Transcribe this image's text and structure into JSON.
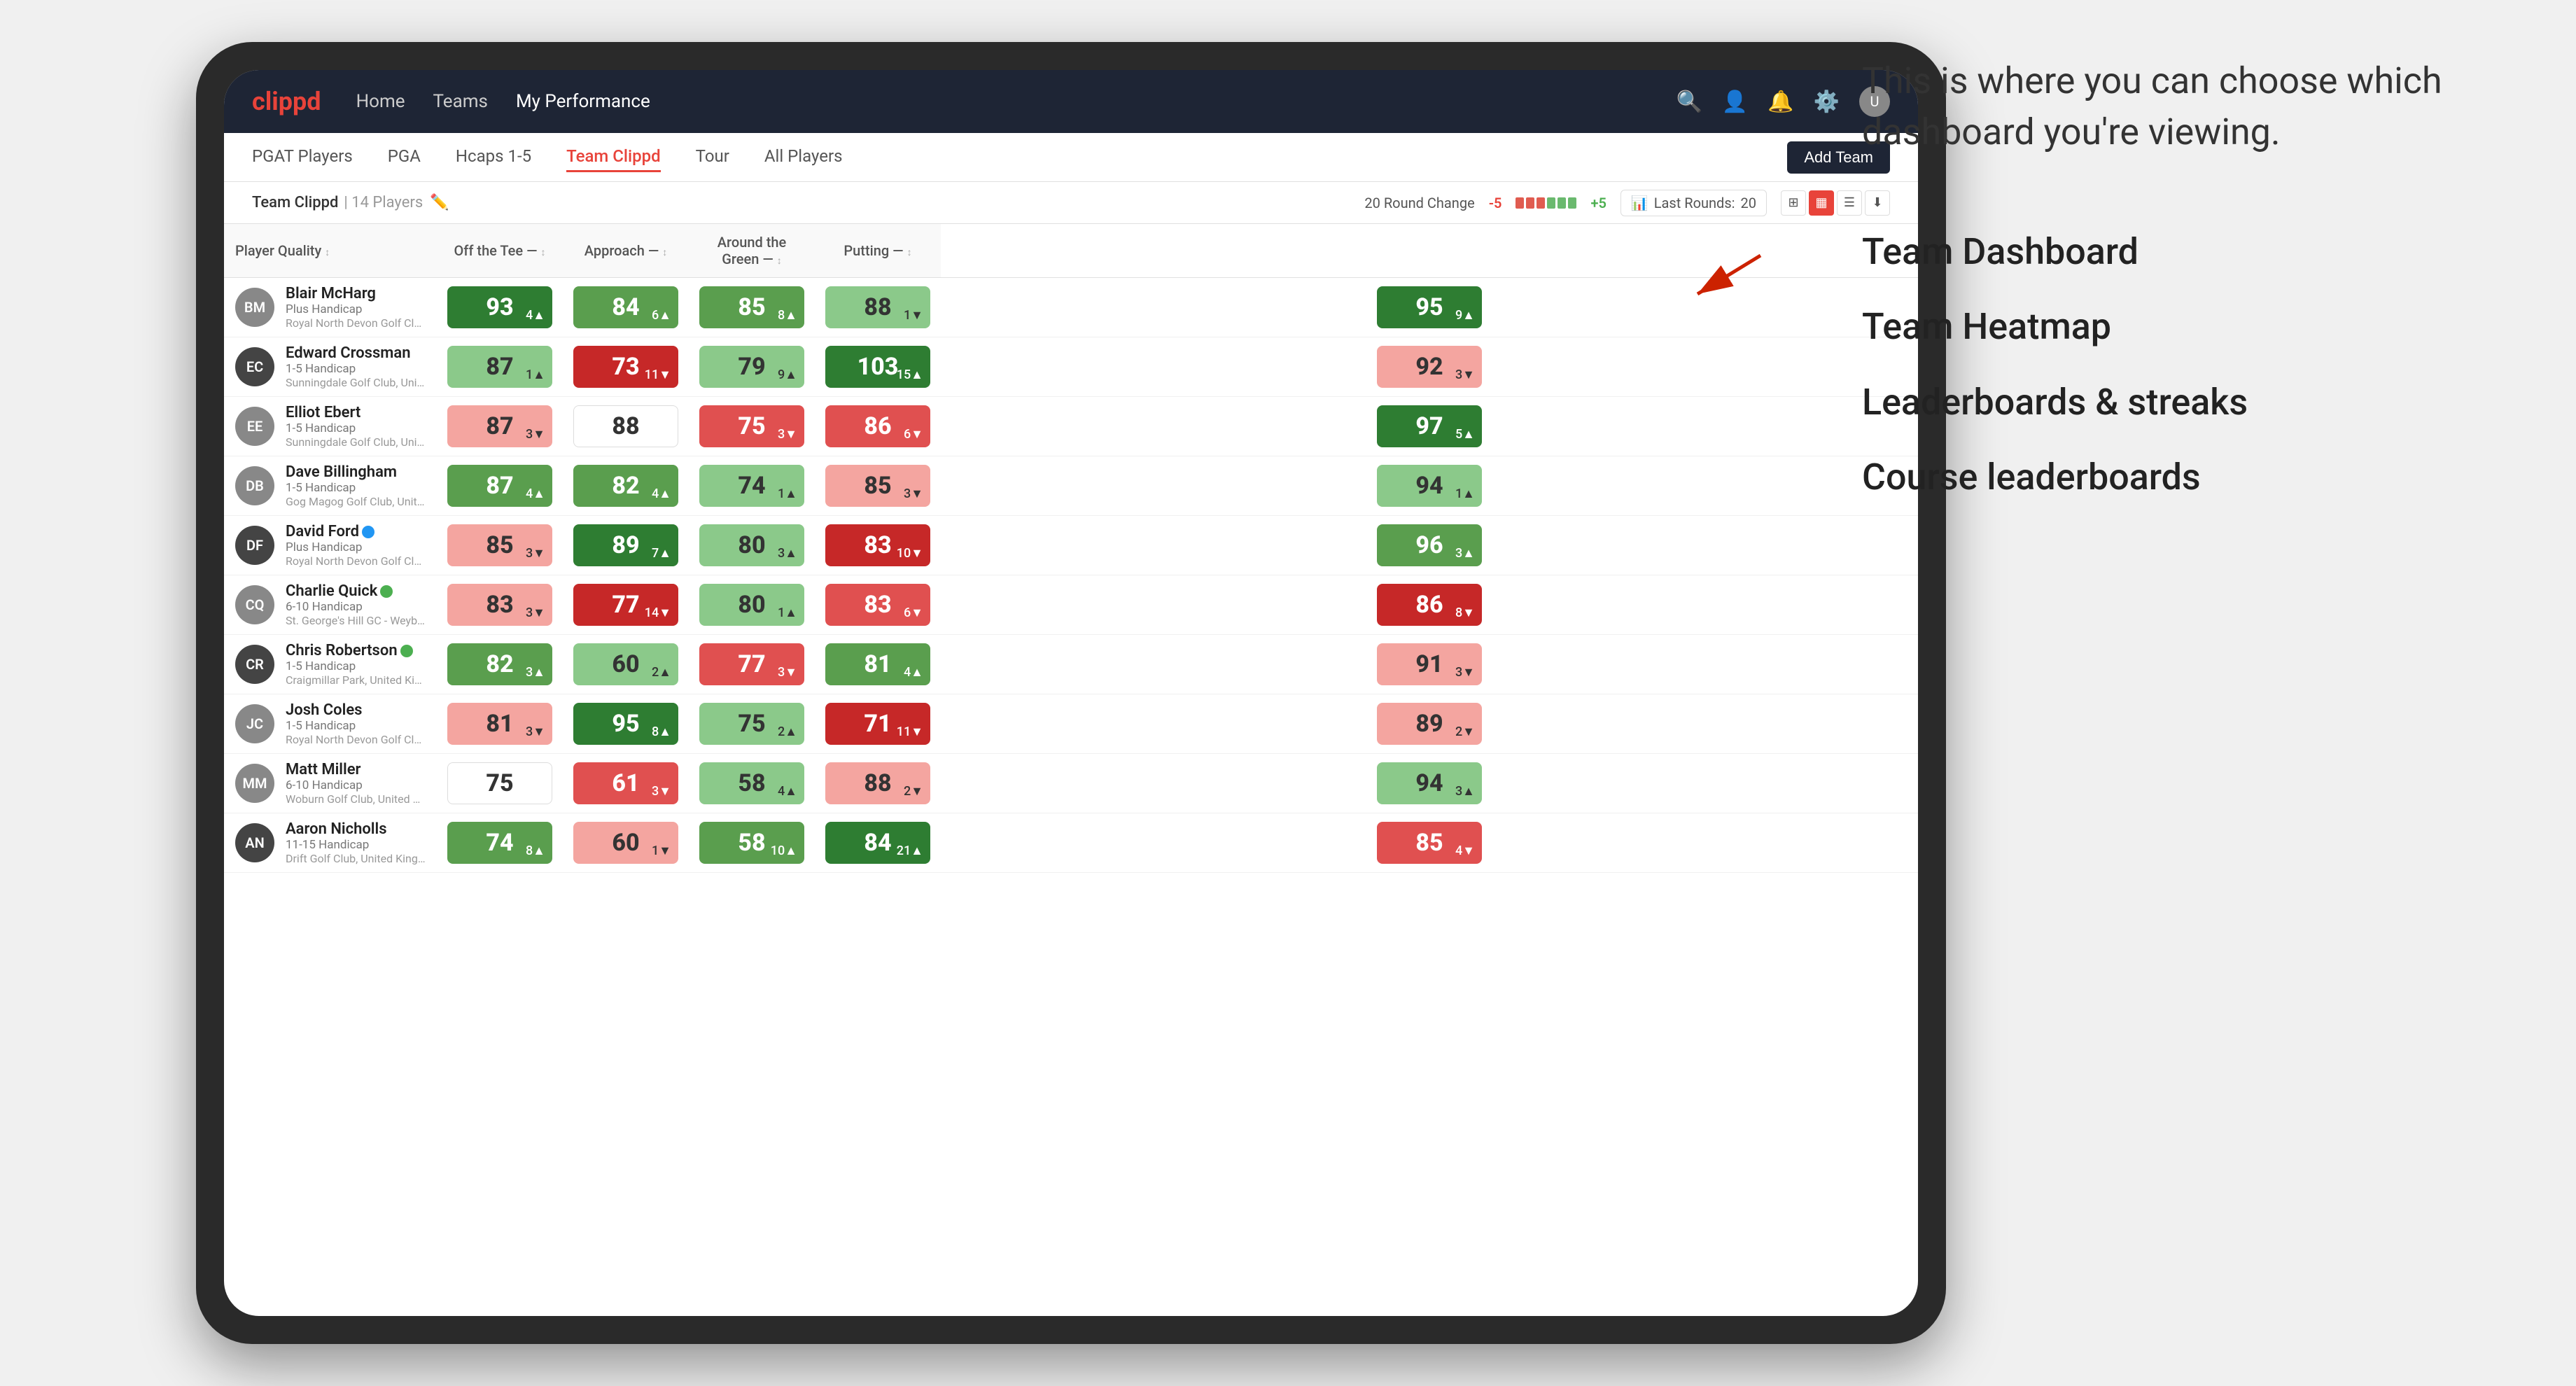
{
  "annotation": {
    "intro": "This is where you can choose which dashboard you're viewing.",
    "options": [
      "Team Dashboard",
      "Team Heatmap",
      "Leaderboards & streaks",
      "Course leaderboards"
    ]
  },
  "nav": {
    "logo": "clippd",
    "links": [
      "Home",
      "Teams",
      "My Performance"
    ],
    "active_link": "My Performance"
  },
  "subnav": {
    "links": [
      "PGAT Players",
      "PGA",
      "Hcaps 1-5",
      "Team Clippd",
      "Tour",
      "All Players"
    ],
    "active_link": "Team Clippd",
    "add_team_label": "Add Team"
  },
  "team_header": {
    "team_name": "Team Clippd",
    "separator": "|",
    "player_count": "14 Players",
    "round_change_label": "20 Round Change",
    "change_neg": "-5",
    "change_pos": "+5",
    "last_rounds_label": "Last Rounds:",
    "last_rounds_value": "20"
  },
  "table": {
    "columns": {
      "player": "Player Quality",
      "off_tee": "Off the Tee",
      "approach": "Approach",
      "around_green": "Around the Green",
      "putting": "Putting"
    },
    "players": [
      {
        "name": "Blair McHarg",
        "hcap": "Plus Handicap",
        "club": "Royal North Devon Golf Club, United Kingdom",
        "avatar_initials": "BM",
        "avatar_style": "medium",
        "player_quality": {
          "value": "93",
          "change": "4",
          "dir": "up",
          "color": "green-dark"
        },
        "off_tee": {
          "value": "84",
          "change": "6",
          "dir": "up",
          "color": "green-mid"
        },
        "approach": {
          "value": "85",
          "change": "8",
          "dir": "up",
          "color": "green-mid"
        },
        "around_green": {
          "value": "88",
          "change": "1",
          "dir": "dn",
          "color": "green-light"
        },
        "putting": {
          "value": "95",
          "change": "9",
          "dir": "up",
          "color": "green-dark"
        }
      },
      {
        "name": "Edward Crossman",
        "hcap": "1-5 Handicap",
        "club": "Sunningdale Golf Club, United Kingdom",
        "avatar_initials": "EC",
        "avatar_style": "dark",
        "player_quality": {
          "value": "87",
          "change": "1",
          "dir": "up",
          "color": "green-light"
        },
        "off_tee": {
          "value": "73",
          "change": "11",
          "dir": "dn",
          "color": "red-dark"
        },
        "approach": {
          "value": "79",
          "change": "9",
          "dir": "up",
          "color": "green-light"
        },
        "around_green": {
          "value": "103",
          "change": "15",
          "dir": "up",
          "color": "green-dark"
        },
        "putting": {
          "value": "92",
          "change": "3",
          "dir": "dn",
          "color": "red-light"
        }
      },
      {
        "name": "Elliot Ebert",
        "hcap": "1-5 Handicap",
        "club": "Sunningdale Golf Club, United Kingdom",
        "avatar_initials": "EE",
        "avatar_style": "medium",
        "player_quality": {
          "value": "87",
          "change": "3",
          "dir": "dn",
          "color": "red-light"
        },
        "off_tee": {
          "value": "88",
          "change": "",
          "dir": "",
          "color": "neutral"
        },
        "approach": {
          "value": "75",
          "change": "3",
          "dir": "dn",
          "color": "red-mid"
        },
        "around_green": {
          "value": "86",
          "change": "6",
          "dir": "dn",
          "color": "red-mid"
        },
        "putting": {
          "value": "97",
          "change": "5",
          "dir": "up",
          "color": "green-dark"
        }
      },
      {
        "name": "Dave Billingham",
        "hcap": "1-5 Handicap",
        "club": "Gog Magog Golf Club, United Kingdom",
        "avatar_initials": "DB",
        "avatar_style": "medium",
        "player_quality": {
          "value": "87",
          "change": "4",
          "dir": "up",
          "color": "green-mid"
        },
        "off_tee": {
          "value": "82",
          "change": "4",
          "dir": "up",
          "color": "green-mid"
        },
        "approach": {
          "value": "74",
          "change": "1",
          "dir": "up",
          "color": "green-light"
        },
        "around_green": {
          "value": "85",
          "change": "3",
          "dir": "dn",
          "color": "red-light"
        },
        "putting": {
          "value": "94",
          "change": "1",
          "dir": "up",
          "color": "green-light"
        }
      },
      {
        "name": "David Ford",
        "hcap": "Plus Handicap",
        "club": "Royal North Devon Golf Club, United Kingdom",
        "avatar_initials": "DF",
        "avatar_style": "dark",
        "has_badge": true,
        "badge_color": "blue",
        "player_quality": {
          "value": "85",
          "change": "3",
          "dir": "dn",
          "color": "red-light"
        },
        "off_tee": {
          "value": "89",
          "change": "7",
          "dir": "up",
          "color": "green-dark"
        },
        "approach": {
          "value": "80",
          "change": "3",
          "dir": "up",
          "color": "green-light"
        },
        "around_green": {
          "value": "83",
          "change": "10",
          "dir": "dn",
          "color": "red-dark"
        },
        "putting": {
          "value": "96",
          "change": "3",
          "dir": "up",
          "color": "green-mid"
        }
      },
      {
        "name": "Charlie Quick",
        "hcap": "6-10 Handicap",
        "club": "St. George's Hill GC - Weybridge - Surrey, Uni...",
        "avatar_initials": "CQ",
        "avatar_style": "medium",
        "has_badge": true,
        "badge_color": "green",
        "player_quality": {
          "value": "83",
          "change": "3",
          "dir": "dn",
          "color": "red-light"
        },
        "off_tee": {
          "value": "77",
          "change": "14",
          "dir": "dn",
          "color": "red-dark"
        },
        "approach": {
          "value": "80",
          "change": "1",
          "dir": "up",
          "color": "green-light"
        },
        "around_green": {
          "value": "83",
          "change": "6",
          "dir": "dn",
          "color": "red-mid"
        },
        "putting": {
          "value": "86",
          "change": "8",
          "dir": "dn",
          "color": "red-dark"
        }
      },
      {
        "name": "Chris Robertson",
        "hcap": "1-5 Handicap",
        "club": "Craigmillar Park, United Kingdom",
        "avatar_initials": "CR",
        "avatar_style": "dark",
        "has_badge": true,
        "badge_color": "green",
        "player_quality": {
          "value": "82",
          "change": "3",
          "dir": "up",
          "color": "green-mid"
        },
        "off_tee": {
          "value": "60",
          "change": "2",
          "dir": "up",
          "color": "green-light"
        },
        "approach": {
          "value": "77",
          "change": "3",
          "dir": "dn",
          "color": "red-mid"
        },
        "around_green": {
          "value": "81",
          "change": "4",
          "dir": "up",
          "color": "green-mid"
        },
        "putting": {
          "value": "91",
          "change": "3",
          "dir": "dn",
          "color": "red-light"
        }
      },
      {
        "name": "Josh Coles",
        "hcap": "1-5 Handicap",
        "club": "Royal North Devon Golf Club, United Kingdom",
        "avatar_initials": "JC",
        "avatar_style": "medium",
        "player_quality": {
          "value": "81",
          "change": "3",
          "dir": "dn",
          "color": "red-light"
        },
        "off_tee": {
          "value": "95",
          "change": "8",
          "dir": "up",
          "color": "green-dark"
        },
        "approach": {
          "value": "75",
          "change": "2",
          "dir": "up",
          "color": "green-light"
        },
        "around_green": {
          "value": "71",
          "change": "11",
          "dir": "dn",
          "color": "red-dark"
        },
        "putting": {
          "value": "89",
          "change": "2",
          "dir": "dn",
          "color": "red-light"
        }
      },
      {
        "name": "Matt Miller",
        "hcap": "6-10 Handicap",
        "club": "Woburn Golf Club, United Kingdom",
        "avatar_initials": "MM",
        "avatar_style": "medium",
        "player_quality": {
          "value": "75",
          "change": "",
          "dir": "",
          "color": "neutral"
        },
        "off_tee": {
          "value": "61",
          "change": "3",
          "dir": "dn",
          "color": "red-mid"
        },
        "approach": {
          "value": "58",
          "change": "4",
          "dir": "up",
          "color": "green-light"
        },
        "around_green": {
          "value": "88",
          "change": "2",
          "dir": "dn",
          "color": "red-light"
        },
        "putting": {
          "value": "94",
          "change": "3",
          "dir": "up",
          "color": "green-light"
        }
      },
      {
        "name": "Aaron Nicholls",
        "hcap": "11-15 Handicap",
        "club": "Drift Golf Club, United Kingdom",
        "avatar_initials": "AN",
        "avatar_style": "dark",
        "player_quality": {
          "value": "74",
          "change": "8",
          "dir": "up",
          "color": "green-mid"
        },
        "off_tee": {
          "value": "60",
          "change": "1",
          "dir": "dn",
          "color": "red-light"
        },
        "approach": {
          "value": "58",
          "change": "10",
          "dir": "up",
          "color": "green-mid"
        },
        "around_green": {
          "value": "84",
          "change": "21",
          "dir": "up",
          "color": "green-dark"
        },
        "putting": {
          "value": "85",
          "change": "4",
          "dir": "dn",
          "color": "red-mid"
        }
      }
    ]
  }
}
